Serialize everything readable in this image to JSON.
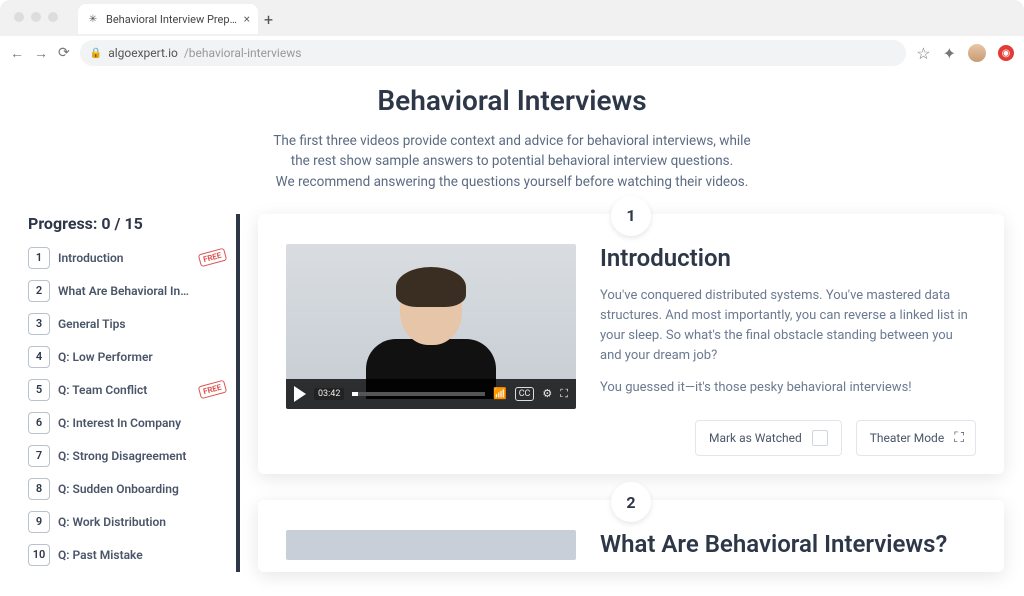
{
  "browser": {
    "tab_title": "Behavioral Interview Prep | Alg",
    "url_host": "algoexpert.io",
    "url_path": "/behavioral-interviews"
  },
  "header": {
    "title": "Behavioral Interviews",
    "line1": "The first three videos provide context and advice for behavioral interviews, while",
    "line2": "the rest show sample answers to potential behavioral interview questions.",
    "line3": "We recommend answering the questions yourself before watching their videos."
  },
  "sidebar": {
    "progress_label": "Progress: 0 / 15",
    "items": [
      {
        "n": "1",
        "label": "Introduction",
        "free": true
      },
      {
        "n": "2",
        "label": "What Are Behavioral In…",
        "free": false
      },
      {
        "n": "3",
        "label": "General Tips",
        "free": false
      },
      {
        "n": "4",
        "label": "Q: Low Performer",
        "free": false
      },
      {
        "n": "5",
        "label": "Q: Team Conflict",
        "free": true
      },
      {
        "n": "6",
        "label": "Q: Interest In Company",
        "free": false
      },
      {
        "n": "7",
        "label": "Q: Strong Disagreement",
        "free": false
      },
      {
        "n": "8",
        "label": "Q: Sudden Onboarding",
        "free": false
      },
      {
        "n": "9",
        "label": "Q: Work Distribution",
        "free": false
      },
      {
        "n": "10",
        "label": "Q: Past Mistake",
        "free": false
      }
    ],
    "free_tag": "FREE"
  },
  "card1": {
    "num": "1",
    "title": "Introduction",
    "p1": "You've conquered distributed systems. You've mastered data structures. And most importantly, you can reverse a linked list in your sleep. So what's the final obstacle standing between you and your dream job?",
    "p2": "You guessed it—it's those pesky behavioral interviews!",
    "video_time": "03:42",
    "cc": "CC",
    "mark_watched": "Mark as Watched",
    "theater": "Theater Mode"
  },
  "card2": {
    "num": "2",
    "title": "What Are Behavioral Interviews?"
  }
}
